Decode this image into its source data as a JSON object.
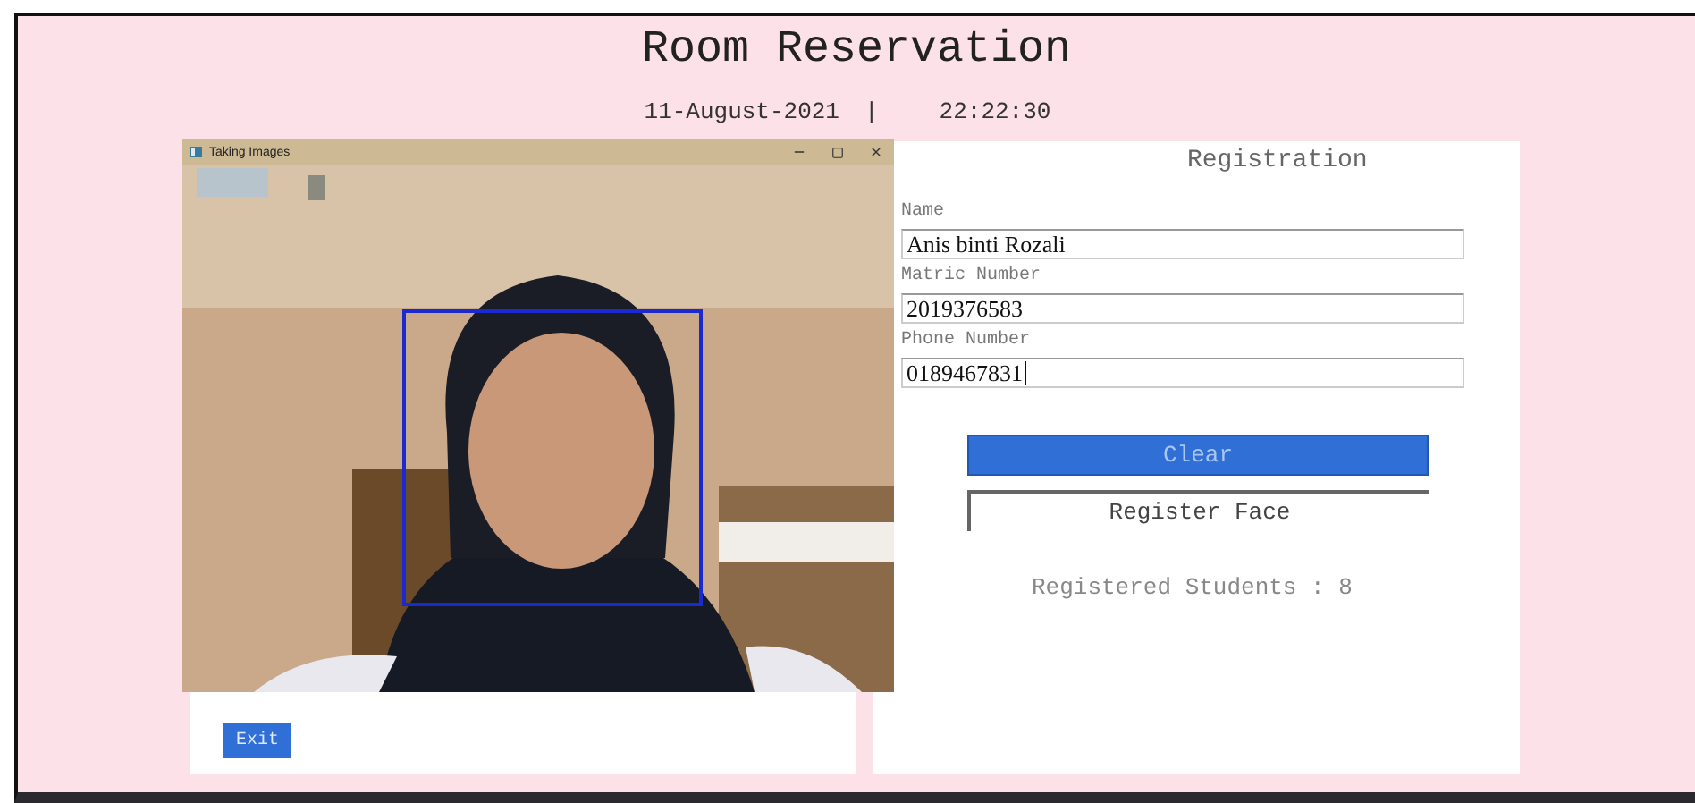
{
  "header": {
    "title": "Room Reservation",
    "date": "11-August-2021",
    "separator": "|",
    "time": "22:22:30"
  },
  "camera_window": {
    "title": "Taking Images"
  },
  "left_panel": {
    "exit_button": "Exit"
  },
  "registration": {
    "title": "Registration",
    "fields": [
      {
        "label": "Name",
        "value": "Anis binti Rozali",
        "focused": false
      },
      {
        "label": "Matric Number",
        "value": "2019376583",
        "focused": false
      },
      {
        "label": "Phone Number",
        "value": "0189467831",
        "focused": true
      }
    ],
    "buttons": [
      {
        "label": "Clear",
        "kind": "primary"
      },
      {
        "label": "Register Face",
        "kind": "outline"
      }
    ],
    "registered_count": "Registered Students : 8"
  }
}
